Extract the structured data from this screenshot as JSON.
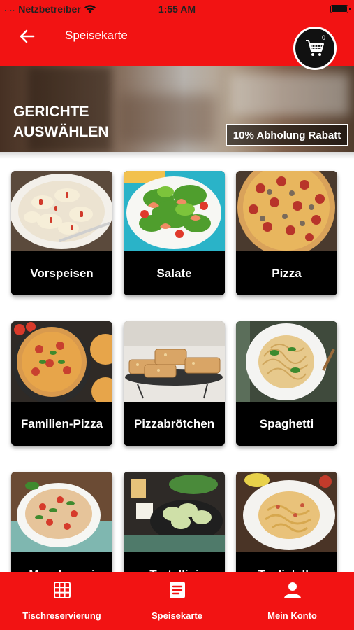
{
  "status_bar": {
    "signal": "....",
    "carrier": "Netzbetreiber",
    "time": "1:55 AM"
  },
  "nav": {
    "title": "Speisekarte",
    "back_icon": "arrow-left-icon",
    "cart_icon": "shopping-cart-icon",
    "cart_count": "0"
  },
  "banner": {
    "title_line1": "GERICHTE",
    "title_line2": "AUSWÄHLEN",
    "discount_label": "10% Abholung Rabatt"
  },
  "categories": [
    {
      "label": "Vorspeisen",
      "image": "pasta-with-cheese"
    },
    {
      "label": "Salate",
      "image": "shrimp-salad"
    },
    {
      "label": "Pizza",
      "image": "salami-pizza"
    },
    {
      "label": "Familien-Pizza",
      "image": "family-pizza"
    },
    {
      "label": "Pizzabrötchen",
      "image": "pizza-rolls"
    },
    {
      "label": "Spaghetti",
      "image": "spaghetti-plate"
    },
    {
      "label": "Maccheroni",
      "image": "maccheroni-bowl"
    },
    {
      "label": "Tortellini",
      "image": "tortellini-pan"
    },
    {
      "label": "Tagliatelle",
      "image": "tagliatelle-plate"
    }
  ],
  "tabbar": {
    "items": [
      {
        "label": "Tischreservierung",
        "icon": "grid-icon"
      },
      {
        "label": "Speisekarte",
        "icon": "menu-list-icon"
      },
      {
        "label": "Mein Konto",
        "icon": "user-icon"
      }
    ]
  },
  "colors": {
    "brand_red": "#f21313",
    "card_label_bg": "#000000",
    "text_light": "#ffffff"
  }
}
